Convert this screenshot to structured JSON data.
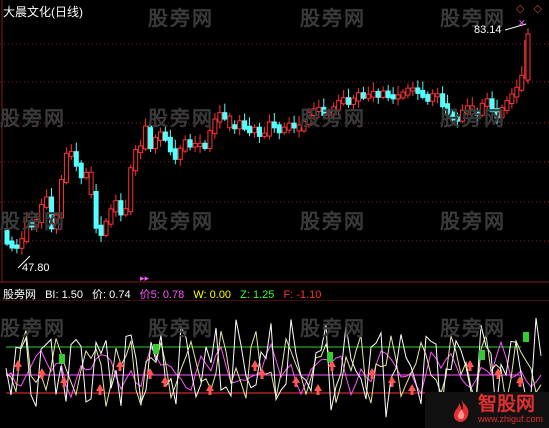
{
  "title": "大晨文化(日线)",
  "high_label": "83.14",
  "low_label": "47.80",
  "corner_icons": "◇ ◇",
  "indicator": {
    "name": "股旁网",
    "bi_label": "BI: 1.50",
    "jia_label": "价: 0.74",
    "jia5_label": "价5: 0.78",
    "w_label": "W: 0.00",
    "z_label": "Z: 1.25",
    "f_label": "F: -1.10"
  },
  "watermark": "股旁网",
  "brand": {
    "cn": "智股网",
    "en": "www.zhiguf.com"
  },
  "colors": {
    "up": "#ff3232",
    "down": "#54ffff",
    "guide": "#802020",
    "sig_up": "#ff5555",
    "sig_green": "#33cc33",
    "line_white": "#ffffff",
    "line_magenta": "#ff55ff",
    "level_green": "#33cc33",
    "level_red": "#ff3333",
    "bi": "#ffffff",
    "jia": "#ffffff",
    "jia5": "#ff55ff",
    "w": "#ffff00",
    "z": "#33ff33",
    "f": "#ff3333"
  }
}
